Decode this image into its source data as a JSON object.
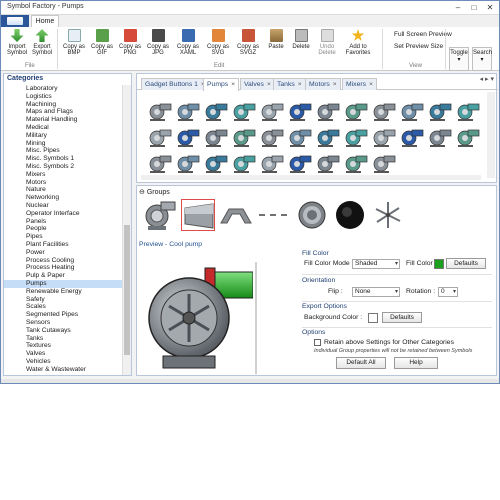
{
  "window": {
    "title": "Symbol Factory - Pumps"
  },
  "ribbon": {
    "home_tab": "Home",
    "buttons": [
      {
        "label": "Import Symbol",
        "icon": "import-icon"
      },
      {
        "label": "Export Symbol",
        "icon": "export-icon"
      },
      {
        "label": "Copy as BMP",
        "icon": "bmp-icon"
      },
      {
        "label": "Copy as GIF",
        "icon": "gif-icon"
      },
      {
        "label": "Copy as PNG",
        "icon": "png-icon"
      },
      {
        "label": "Copy as JPG",
        "icon": "jpg-icon"
      },
      {
        "label": "Copy as XAML",
        "icon": "xaml-icon"
      },
      {
        "label": "Copy as SVG",
        "icon": "svg-icon"
      },
      {
        "label": "Copy as SVGZ",
        "icon": "svgz-icon"
      },
      {
        "label": "Paste",
        "icon": "paste-icon"
      },
      {
        "label": "Delete",
        "icon": "delete-icon"
      },
      {
        "label": "Undo Delete",
        "icon": "undo-icon"
      },
      {
        "label": "Add to Favorites",
        "icon": "star-icon"
      }
    ],
    "groups": {
      "file": "File",
      "edit": "Edit",
      "view": "View"
    },
    "full_screen_preview": "Full Screen Preview",
    "set_preview_size": "Set Preview Size",
    "toggle": "Toggle",
    "search": "Search"
  },
  "sidebar": {
    "title": "Categories",
    "items": [
      "Laboratory",
      "Logistics",
      "Machining",
      "Maps and Flags",
      "Material Handling",
      "Medical",
      "Military",
      "Mining",
      "Misc. Pipes",
      "Misc. Symbols 1",
      "Misc. Symbols 2",
      "Mixers",
      "Motors",
      "Nature",
      "Networking",
      "Nuclear",
      "Operator Interface",
      "Panels",
      "People",
      "Pipes",
      "Plant Facilities",
      "Power",
      "Process Cooling",
      "Process Heating",
      "Pulp & Paper",
      "Pumps",
      "Renewable Energy",
      "Safety",
      "Scales",
      "Segmented Pipes",
      "Sensors",
      "Tank Cutaways",
      "Tanks",
      "Textures",
      "Valves",
      "Vehicles",
      "Water & Wastewater"
    ],
    "selected": "Pumps"
  },
  "tabs": [
    "Gadget Buttons 1",
    "Pumps",
    "Valves",
    "Tanks",
    "Motors",
    "Mixers"
  ],
  "active_tab": "Pumps",
  "groups_panel": {
    "title": "Groups",
    "preview_label": "Preview - Cool pump"
  },
  "properties": {
    "fill_color_section": "Fill Color",
    "fill_color_mode_label": "Fill Color Mode",
    "fill_color_mode_value": "Shaded",
    "fill_color_label": "Fill Color",
    "fill_color_value": "#1aa01a",
    "defaults_label": "Defaults",
    "orientation_section": "Orientation",
    "flip_label": "Flip :",
    "flip_value": "None",
    "rotation_label": "Rotation :",
    "rotation_value": "0",
    "export_options_section": "Export Options",
    "background_color_label": "Background Color :",
    "options_section": "Options",
    "retain_label": "Retain above Settings for Other Categories",
    "note": "Individual Group properties will not be retained between Symbols",
    "default_all": "Default All",
    "help": "Help"
  }
}
